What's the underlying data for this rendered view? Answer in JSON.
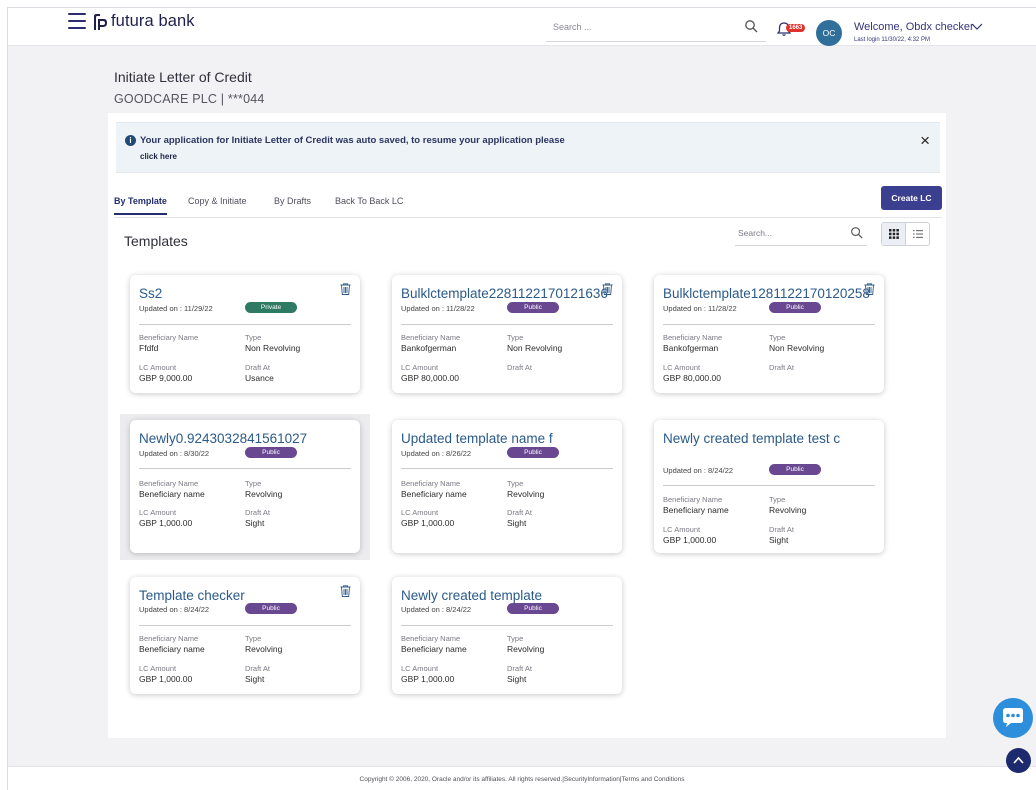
{
  "header": {
    "logo_text": "futura bank",
    "search_placeholder": "Search ...",
    "notification_count": "1663",
    "avatar_initials": "OC",
    "welcome": "Welcome, Obdx checker",
    "last_login": "Last login 11/30/22, 4:32 PM"
  },
  "page": {
    "title": "Initiate Letter of Credit",
    "subtitle": "GOODCARE PLC | ***044"
  },
  "banner": {
    "message": "Your application for Initiate Letter of Credit was auto saved, to resume your application please",
    "link": "click here",
    "close": "×"
  },
  "tabs": [
    {
      "label": "By Template",
      "active": true
    },
    {
      "label": "Copy & Initiate",
      "active": false
    },
    {
      "label": "By Drafts",
      "active": false
    },
    {
      "label": "Back To Back LC",
      "active": false
    }
  ],
  "create_lc_label": "Create LC",
  "templates": {
    "title": "Templates",
    "search_placeholder": "Search...",
    "field_labels": {
      "beneficiary": "Beneficiary Name",
      "type": "Type",
      "amount": "LC Amount",
      "draft": "Draft At"
    },
    "cards": [
      {
        "name": "Ss2",
        "updated": "Updated on : 11/29/22",
        "visibility": "Private",
        "beneficiary": "Ffdfd",
        "type": "Non Revolving",
        "amount": "GBP 9,000.00",
        "draft_at": "Usance",
        "deletable": true
      },
      {
        "name": "Bulklctemplate2281122170121636",
        "updated": "Updated on : 11/28/22",
        "visibility": "Public",
        "beneficiary": "Bankofgerman",
        "type": "Non Revolving",
        "amount": "GBP 80,000.00",
        "draft_at": "",
        "deletable": true
      },
      {
        "name": "Bulklctemplate1281122170120258",
        "updated": "Updated on : 11/28/22",
        "visibility": "Public",
        "beneficiary": "Bankofgerman",
        "type": "Non Revolving",
        "amount": "GBP 80,000.00",
        "draft_at": "",
        "deletable": true
      },
      {
        "name": "Newly0.9243032841561027",
        "updated": "Updated on : 8/30/22",
        "visibility": "Public",
        "beneficiary": "Beneficiary name",
        "type": "Revolving",
        "amount": "GBP 1,000.00",
        "draft_at": "Sight",
        "deletable": false
      },
      {
        "name": "Updated template name f",
        "updated": "Updated on : 8/26/22",
        "visibility": "Public",
        "beneficiary": "Beneficiary name",
        "type": "Revolving",
        "amount": "GBP 1,000.00",
        "draft_at": "Sight",
        "deletable": false
      },
      {
        "name": "Newly created template test c",
        "updated": "Updated on : 8/24/22",
        "visibility": "Public",
        "beneficiary": "Beneficiary name",
        "type": "Revolving",
        "amount": "GBP 1,000.00",
        "draft_at": "Sight",
        "deletable": false
      },
      {
        "name": "Template checker",
        "updated": "Updated on : 8/24/22",
        "visibility": "Public",
        "beneficiary": "Beneficiary name",
        "type": "Revolving",
        "amount": "GBP 1,000.00",
        "draft_at": "Sight",
        "deletable": true
      },
      {
        "name": "Newly created template",
        "updated": "Updated on : 8/24/22",
        "visibility": "Public",
        "beneficiary": "Beneficiary name",
        "type": "Revolving",
        "amount": "GBP 1,000.00",
        "draft_at": "Sight",
        "deletable": false
      }
    ]
  },
  "footer": "Copyright © 2006, 2020, Oracle and/or its affiliates. All rights reserved.|SecurityInformation|Terms and Conditions",
  "colors": {
    "brand_navy": "#232d70",
    "button": "#3b3f8f",
    "template_name": "#2a5a8a",
    "pill_private": "#2f7a63",
    "pill_public": "#6a4891",
    "chat_fab": "#2d8fdc"
  },
  "icons": [
    "hamburger-icon",
    "futura-logo-icon",
    "search-icon",
    "bell-icon",
    "chevron-down-icon",
    "info-icon",
    "close-icon",
    "grid-view-icon",
    "list-view-icon",
    "trash-icon",
    "chat-icon",
    "chevron-up-icon"
  ]
}
